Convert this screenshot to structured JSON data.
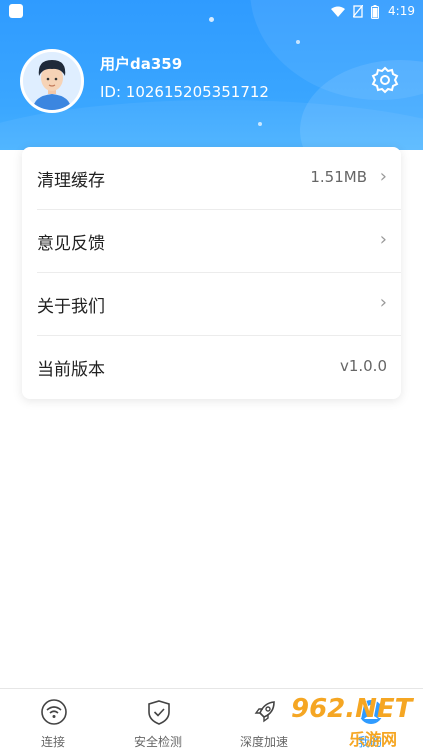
{
  "status_bar": {
    "time": "4:19",
    "icons": [
      "wifi-icon",
      "no-sim-icon",
      "battery-icon"
    ]
  },
  "profile": {
    "username": "用户da359",
    "id_text": "ID: 102615205351712"
  },
  "settings": [
    {
      "label": "清理缓存",
      "value": "1.51MB",
      "chevron": true
    },
    {
      "label": "意见反馈",
      "value": "",
      "chevron": true
    },
    {
      "label": "关于我们",
      "value": "",
      "chevron": true
    },
    {
      "label": "当前版本",
      "value": "v1.0.0",
      "chevron": false
    }
  ],
  "tabs": [
    {
      "label": "连接",
      "icon": "wifi-icon"
    },
    {
      "label": "安全检测",
      "icon": "shield-icon"
    },
    {
      "label": "深度加速",
      "icon": "rocket-icon"
    },
    {
      "label": "我的",
      "icon": "user-icon",
      "active": true
    }
  ],
  "watermark": {
    "big": "962.NET",
    "small": "乐游网"
  },
  "colors": {
    "primary": "#2f9bff",
    "header_bg": "#3aa6ff",
    "watermark": "#f5a623"
  }
}
